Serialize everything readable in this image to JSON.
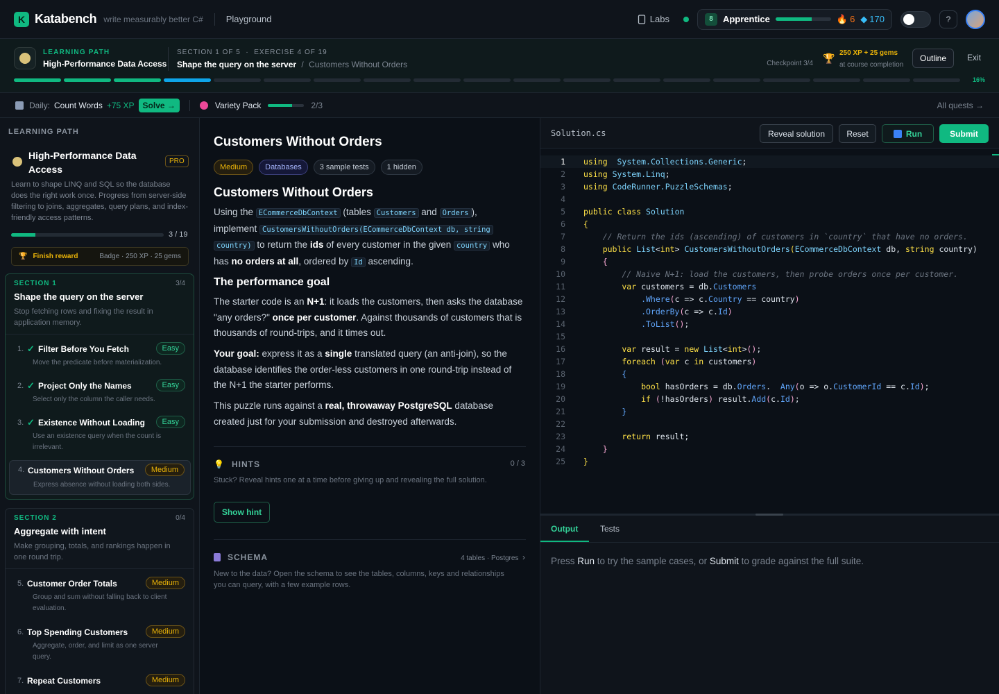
{
  "app": {
    "brand": "Katabench",
    "tagline": "write measurably better C#",
    "nav_playground": "Playground"
  },
  "header": {
    "labs": "Labs",
    "rank_level": "8",
    "rank_name": "Apprentice",
    "rank_progress": 0.65,
    "streak": "6",
    "gems": "170"
  },
  "path": {
    "label": "LEARNING PATH",
    "title": "High-Performance Data Access",
    "section_label": "SECTION 1 OF 5",
    "exercise_label": "EXERCISE 4 OF 19",
    "section_title": "Shape the query on the server",
    "exercise_crumb": "Customers Without Orders",
    "checkpoint": "Checkpoint 3/4",
    "reward": "250 XP + 25 gems",
    "reward_sub": "at course completion",
    "outline": "Outline",
    "exit": "Exit",
    "percent": "16%",
    "segments_done": 3,
    "segments_total": 19
  },
  "quest": {
    "daily_label": "Daily:",
    "daily_name": "Count Words",
    "daily_xp": "+75 XP",
    "solve": "Solve →",
    "variety": "Variety Pack",
    "variety_count": "2/3",
    "variety_progress": 0.66,
    "all": "All quests →"
  },
  "sidebar": {
    "heading": "LEARNING PATH",
    "path_title": "High-Performance Data Access",
    "pro": "PRO",
    "desc": "Learn to shape LINQ and SQL so the database does the right work once. Progress from server-side filtering to joins, aggregates, query plans, and index-friendly access patterns.",
    "progress_count": "3 / 19",
    "progress": 0.158,
    "finish_label": "Finish reward",
    "finish_detail": "Badge · 250 XP · 25 gems",
    "sections": [
      {
        "label": "SECTION 1",
        "count": "3/4",
        "name": "Shape the query on the server",
        "desc": "Stop fetching rows and fixing the result in application memory.",
        "exercises": [
          {
            "num": "1.",
            "title": "Filter Before You Fetch",
            "difficulty": "Easy",
            "desc": "Move the predicate before materialization."
          },
          {
            "num": "2.",
            "title": "Project Only the Names",
            "difficulty": "Easy",
            "desc": "Select only the column the caller needs."
          },
          {
            "num": "3.",
            "title": "Existence Without Loading",
            "difficulty": "Easy",
            "desc": "Use an existence query when the count is irrelevant."
          },
          {
            "num": "4.",
            "title": "Customers Without Orders",
            "difficulty": "Medium",
            "desc": "Express absence without loading both sides."
          }
        ]
      },
      {
        "label": "SECTION 2",
        "count": "0/4",
        "name": "Aggregate with intent",
        "desc": "Make grouping, totals, and rankings happen in one round trip.",
        "exercises": [
          {
            "num": "5.",
            "title": "Customer Order Totals",
            "difficulty": "Medium",
            "desc": "Group and sum without falling back to client evaluation."
          },
          {
            "num": "6.",
            "title": "Top Spending Customers",
            "difficulty": "Medium",
            "desc": "Aggregate, order, and limit as one server query."
          },
          {
            "num": "7.",
            "title": "Repeat Customers",
            "difficulty": "Medium",
            "desc": ""
          }
        ]
      }
    ]
  },
  "problem": {
    "title": "Customers Without Orders",
    "tags": [
      "Medium",
      "Databases",
      "3 sample tests",
      "1 hidden"
    ],
    "heading": "Customers Without Orders",
    "p1": {
      "a": "Using the ",
      "b": "ECommerceDbContext",
      "c": " (tables ",
      "d": "Customers",
      "e": " and ",
      "f": "Orders",
      "g": "),",
      "h": "implement ",
      "i": "CustomersWithoutOrders(ECommerceDbContext db, string",
      "j": "country)",
      "k": " to return the ",
      "l": "ids",
      "m": " of every customer in the given ",
      "n": "country",
      "o": " who has ",
      "p": "no orders at all",
      "q": ", ordered by ",
      "r": "Id",
      "s": " ascending."
    },
    "goal_heading": "The performance goal",
    "p2": {
      "a": "The starter code is an ",
      "b": "N+1",
      "c": ": it loads the customers, then asks the database \"any orders?\" ",
      "d": "once per customer",
      "e": ". Against thousands of customers that is thousands of round-trips, and it times out."
    },
    "p3": {
      "a": "Your goal:",
      "b": " express it as a ",
      "c": "single",
      "d": " translated query (an anti-join), so the database identifies the order-less customers in one round-trip instead of the N+1 the starter performs."
    },
    "p4": {
      "a": "This puzzle runs against a ",
      "b": "real, throwaway PostgreSQL",
      "c": " database created just for your submission and destroyed afterwards."
    },
    "hints_label": "HINTS",
    "hints_count": "0 / 3",
    "hints_desc": "Stuck? Reveal hints one at a time before giving up and revealing the full solution.",
    "show_hint": "Show hint",
    "schema_label": "SCHEMA",
    "schema_meta": "4 tables · Postgres",
    "schema_desc": "New to the data? Open the schema to see the tables, columns, keys and relationships you can query, with a few example rows."
  },
  "editor": {
    "filename": "Solution.cs",
    "reveal": "Reveal solution",
    "reset": "Reset",
    "run": "Run",
    "submit": "Submit",
    "lines": [
      [
        [
          "kw",
          "using"
        ],
        [
          "",
          "  "
        ],
        [
          "ty",
          "System.Collections.Generic"
        ],
        [
          "",
          ";"
        ]
      ],
      [
        [
          "kw",
          "using"
        ],
        [
          "",
          " "
        ],
        [
          "ty",
          "System.Linq"
        ],
        [
          "",
          ";"
        ]
      ],
      [
        [
          "kw",
          "using"
        ],
        [
          "",
          " "
        ],
        [
          "ty",
          "CodeRunner.PuzzleSchemas"
        ],
        [
          "",
          ";"
        ]
      ],
      [],
      [
        [
          "kw",
          "public class"
        ],
        [
          "",
          " "
        ],
        [
          "ty",
          "Solution"
        ]
      ],
      [
        [
          "kw",
          "{"
        ]
      ],
      [
        [
          "cm",
          "    // Return the ids (ascending) of customers in `country` that have no orders."
        ]
      ],
      [
        [
          "kw",
          "    public"
        ],
        [
          "",
          " "
        ],
        [
          "ty",
          "List"
        ],
        [
          "",
          "<"
        ],
        [
          "kw",
          "int"
        ],
        [
          "",
          "> "
        ],
        [
          "ty",
          "CustomersWithoutOrders"
        ],
        [
          "kw",
          "("
        ],
        [
          "ty",
          "ECommerceDbContext"
        ],
        [
          "",
          " db, "
        ],
        [
          "kw",
          "string"
        ],
        [
          "",
          " country)"
        ]
      ],
      [
        [
          "op",
          "    {"
        ]
      ],
      [
        [
          "cm",
          "        // Naive N+1: load the customers, then probe orders once per customer."
        ]
      ],
      [
        [
          "kw",
          "        var"
        ],
        [
          "",
          " customers = db."
        ],
        [
          "mb",
          "Customers"
        ]
      ],
      [
        [
          "mb",
          "            .Where"
        ],
        [
          "op",
          "("
        ],
        [
          "",
          "c => c."
        ],
        [
          "mb",
          "Country"
        ],
        [
          "",
          " == country"
        ],
        [
          "op",
          ")"
        ]
      ],
      [
        [
          "mb",
          "            .OrderBy"
        ],
        [
          "op",
          "("
        ],
        [
          "",
          "c => c."
        ],
        [
          "mb",
          "Id"
        ],
        [
          "op",
          ")"
        ]
      ],
      [
        [
          "mb",
          "            .ToList"
        ],
        [
          "op",
          "()"
        ],
        [
          "",
          ";"
        ]
      ],
      [],
      [
        [
          "kw",
          "        var"
        ],
        [
          "",
          " result = "
        ],
        [
          "kw",
          "new"
        ],
        [
          "",
          " "
        ],
        [
          "ty",
          "List"
        ],
        [
          "",
          "<"
        ],
        [
          "kw",
          "int"
        ],
        [
          "",
          ">"
        ],
        [
          "op",
          "()"
        ],
        [
          "",
          ";"
        ]
      ],
      [
        [
          "kw",
          "        foreach"
        ],
        [
          "",
          " "
        ],
        [
          "op",
          "("
        ],
        [
          "kw",
          "var"
        ],
        [
          "",
          " c "
        ],
        [
          "kw",
          "in"
        ],
        [
          "",
          " customers"
        ],
        [
          "op",
          ")"
        ]
      ],
      [
        [
          "mb",
          "        {"
        ]
      ],
      [
        [
          "kw",
          "            bool"
        ],
        [
          "",
          " hasOrders = db."
        ],
        [
          "mb",
          "Orders"
        ],
        [
          "",
          ".  "
        ],
        [
          "mb",
          "Any"
        ],
        [
          "op",
          "("
        ],
        [
          "",
          "o => o."
        ],
        [
          "mb",
          "CustomerId"
        ],
        [
          "",
          " == c."
        ],
        [
          "mb",
          "Id"
        ],
        [
          "op",
          ")"
        ],
        [
          "",
          ";"
        ]
      ],
      [
        [
          "kw",
          "            if"
        ],
        [
          "",
          " "
        ],
        [
          "op",
          "("
        ],
        [
          "",
          "!hasOrders"
        ],
        [
          "op",
          ")"
        ],
        [
          "",
          " result."
        ],
        [
          "mb",
          "Add"
        ],
        [
          "op",
          "("
        ],
        [
          "",
          "c."
        ],
        [
          "mb",
          "Id"
        ],
        [
          "op",
          ")"
        ],
        [
          "",
          ";"
        ]
      ],
      [
        [
          "mb",
          "        }"
        ]
      ],
      [],
      [
        [
          "kw",
          "        return"
        ],
        [
          "",
          " result;"
        ]
      ],
      [
        [
          "op",
          "    }"
        ]
      ],
      [
        [
          "kw",
          "}"
        ]
      ]
    ]
  },
  "output": {
    "tab_output": "Output",
    "tab_tests": "Tests",
    "msg_a": "Press ",
    "msg_b": "Run",
    "msg_c": " to try the sample cases, or ",
    "msg_d": "Submit",
    "msg_e": " to grade against the full suite."
  }
}
